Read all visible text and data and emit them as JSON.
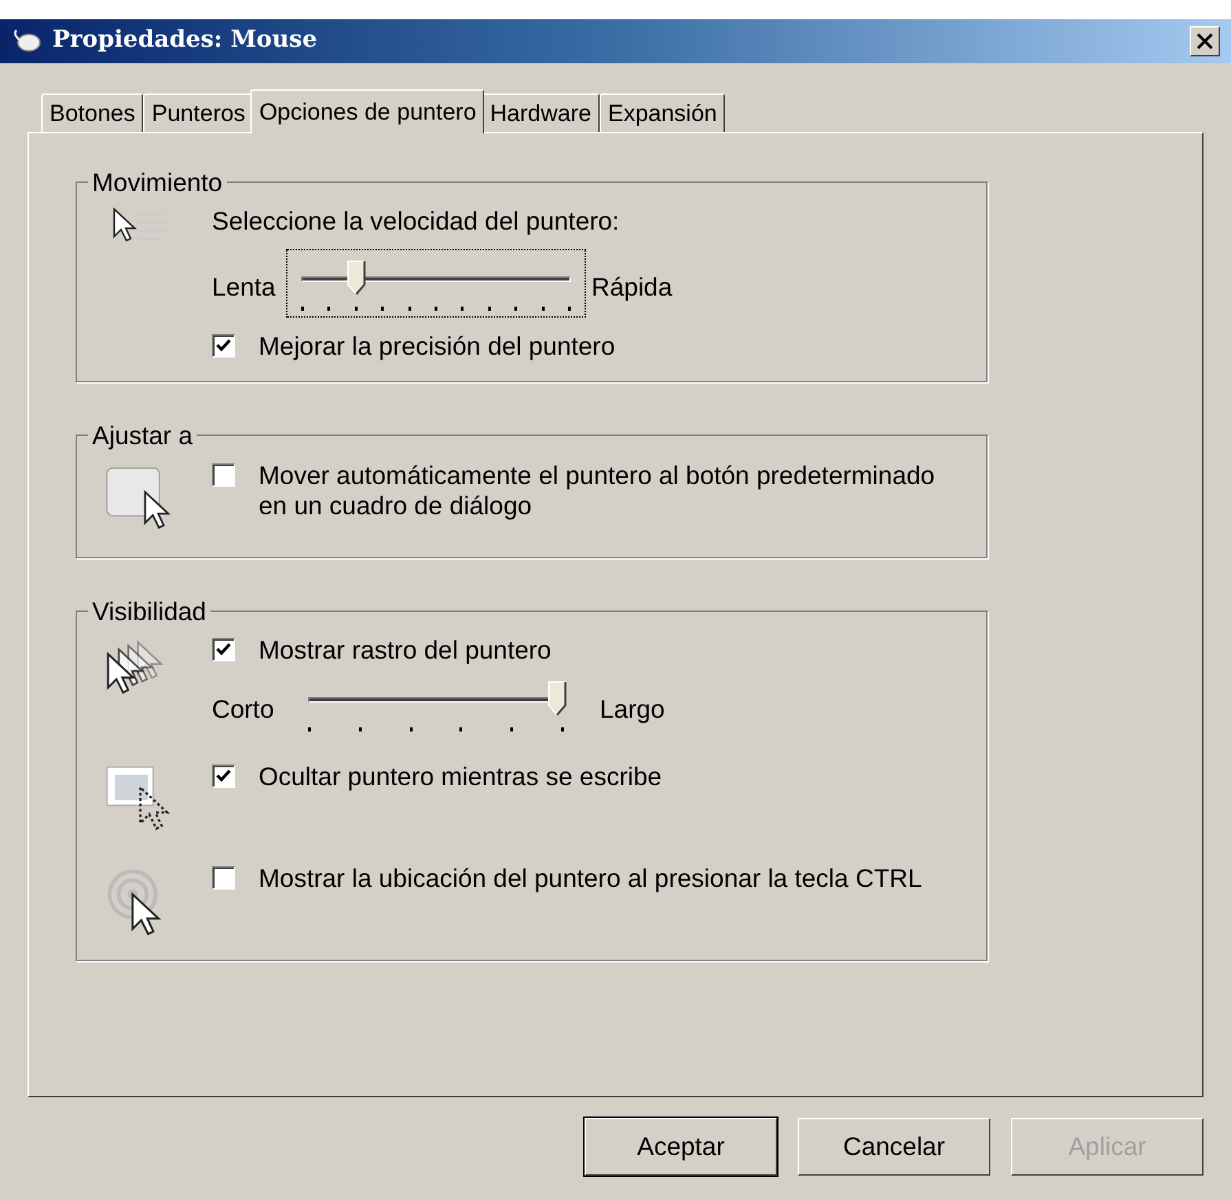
{
  "window": {
    "title": "Propiedades: Mouse"
  },
  "tabs": [
    {
      "label": "Botones",
      "selected": false
    },
    {
      "label": "Punteros",
      "selected": false
    },
    {
      "label": "Opciones de puntero",
      "selected": true
    },
    {
      "label": "Hardware",
      "selected": false
    },
    {
      "label": "Expansión",
      "selected": false
    }
  ],
  "groups": [
    {
      "title": "Movimiento",
      "rows": [
        {
          "items": [
            {
              "kind": "label",
              "text": "Seleccione la velocidad del puntero:"
            },
            {
              "kind": "fineslider",
              "min_label": "Lenta",
              "max_label": "Rápida",
              "level": 0.2,
              "focused": true
            },
            {
              "kind": "checkbox",
              "label": "Mejorar la precisión del puntero",
              "checked": true
            }
          ]
        }
      ]
    },
    {
      "title": "Ajustar a",
      "rows": [
        {
          "items": [
            {
              "kind": "checkbox",
              "label": "Mover automáticamente el puntero al botón predeterminado en un cuadro de diálogo",
              "checked": false
            }
          ]
        }
      ]
    },
    {
      "title": "Visibilidad",
      "rows": [
        {
          "items": [
            {
              "kind": "checkbox",
              "label": "Mostrar rastro del puntero",
              "checked": true
            },
            {
              "kind": "coarseslider",
              "min_label": "Corto",
              "max_label": "Largo",
              "level": 1,
              "focused": false
            }
          ]
        },
        {
          "items": [
            {
              "kind": "checkbox",
              "label": "Ocultar puntero mientras se escribe",
              "checked": true
            }
          ]
        },
        {
          "items": [
            {
              "kind": "checkbox",
              "label": "Mostrar la ubicación del puntero al presionar la tecla CTRL",
              "checked": false
            }
          ]
        }
      ]
    }
  ],
  "buttons": [
    {
      "label": "Aceptar",
      "disabled": false,
      "default": true
    },
    {
      "label": "Cancelar",
      "disabled": false,
      "default": false
    },
    {
      "label": "Aplicar",
      "disabled": true,
      "default": false
    }
  ]
}
